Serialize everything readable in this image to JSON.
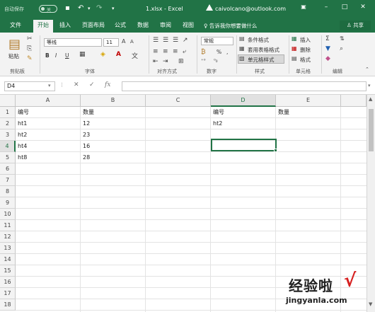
{
  "titlebar": {
    "autosave": "自动保存",
    "autosave_state": "关",
    "filename": "1.xlsx - Excel",
    "account": "caivolcano@outlook.com",
    "minimize": "–",
    "restore": "□",
    "close": "✕"
  },
  "tabs": [
    "文件",
    "开始",
    "插入",
    "页面布局",
    "公式",
    "数据",
    "审阅",
    "视图"
  ],
  "tell_me": "告诉我你想要做什么",
  "share": "共享",
  "ribbon": {
    "clipboard": {
      "label": "剪贴板",
      "paste": "粘贴"
    },
    "font": {
      "label": "字体",
      "name": "等线",
      "size": "11",
      "bold": "B",
      "italic": "I",
      "underline": "U"
    },
    "alignment": {
      "label": "对齐方式"
    },
    "number": {
      "label": "数字",
      "format": "常规",
      "percent": "%",
      "comma": ","
    },
    "styles": {
      "label": "样式",
      "conditional": "条件格式",
      "table": "套用表格格式",
      "cell": "单元格样式"
    },
    "cells": {
      "label": "单元格",
      "insert": "插入",
      "delete": "删除",
      "format": "格式"
    },
    "editing": {
      "label": "编辑"
    }
  },
  "formula_bar": {
    "name_box": "D4",
    "fx": "fx",
    "content": ""
  },
  "columns": [
    "A",
    "B",
    "C",
    "D",
    "E"
  ],
  "rows": [
    "1",
    "2",
    "3",
    "4",
    "5",
    "6",
    "7",
    "8",
    "9",
    "10",
    "11",
    "12",
    "13",
    "14",
    "15",
    "16",
    "17",
    "18"
  ],
  "cells": {
    "A1": "编号",
    "B1": "数量",
    "A2": "ht1",
    "B2": "12",
    "A3": "ht2",
    "B3": "23",
    "A4": "ht4",
    "B4": "16",
    "A5": "ht8",
    "B5": "28",
    "D1": "编号",
    "E1": "数量",
    "D2": "ht2"
  },
  "selected_cell": "D4",
  "watermark": {
    "text": "经验啦",
    "check": "√",
    "url": "jingyanla.com"
  }
}
